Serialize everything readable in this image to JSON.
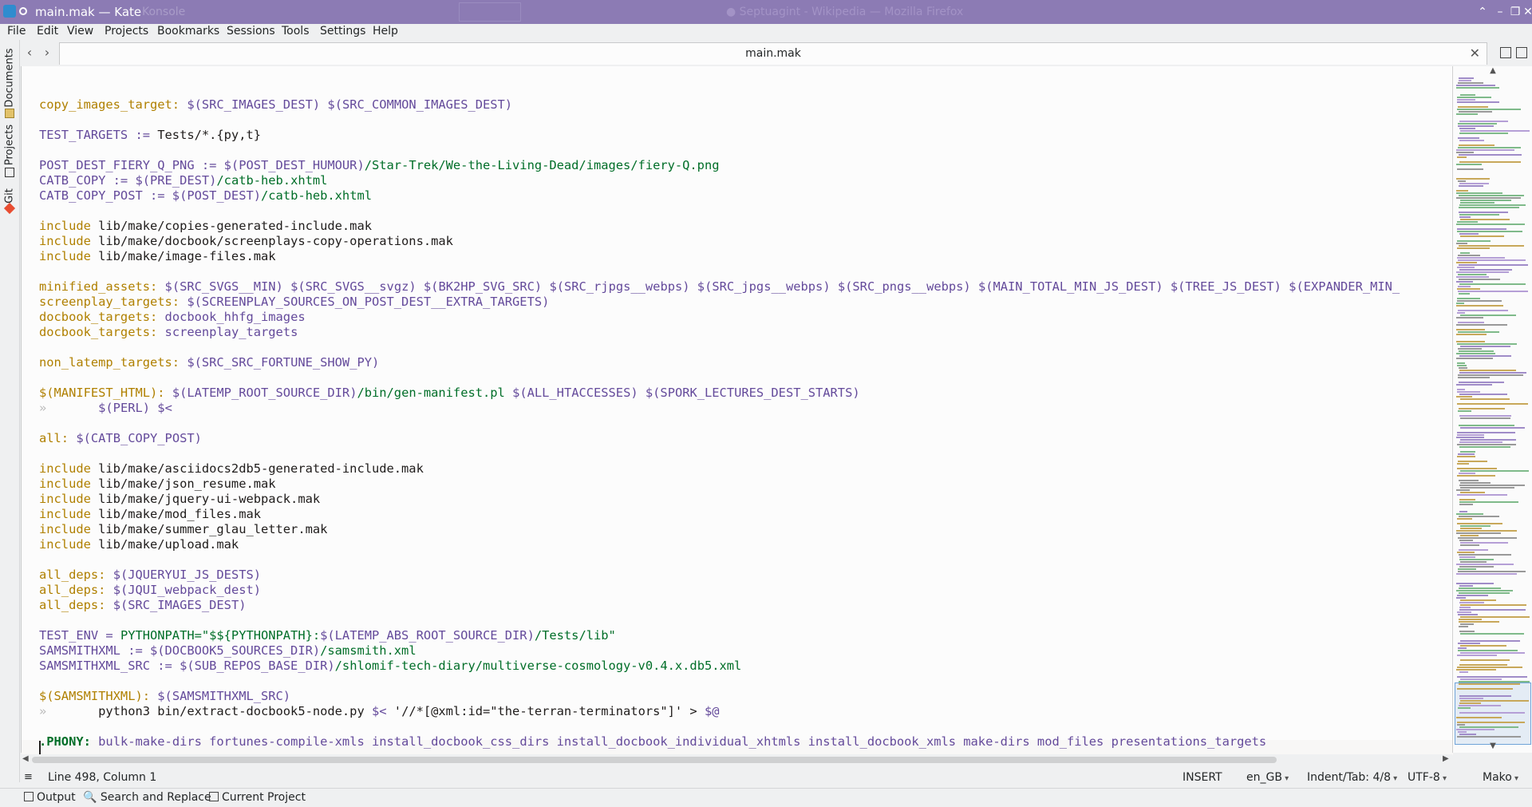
{
  "window": {
    "title": "main.mak — Kate",
    "background_window_1": "Konsole",
    "background_window_2": "Septuagint - Wikipedia — Mozilla Firefox"
  },
  "menu": [
    "File",
    "Edit",
    "View",
    "Projects",
    "Bookmarks",
    "Sessions",
    "Tools",
    "Settings",
    "Help"
  ],
  "sidebar": {
    "documents": "Documents",
    "projects": "Projects",
    "git": "Git"
  },
  "tab": {
    "label": "main.mak"
  },
  "code_lines": [
    [],
    [
      [
        "tgt",
        "copy_images_target:"
      ],
      [
        "plain",
        " "
      ],
      [
        "var",
        "$(SRC_IMAGES_DEST)"
      ],
      [
        "plain",
        " "
      ],
      [
        "var",
        "$(SRC_COMMON_IMAGES_DEST)"
      ]
    ],
    [],
    [
      [
        "var",
        "TEST_TARGETS := "
      ],
      [
        "plain",
        "Tests/*.{py,t}"
      ]
    ],
    [],
    [
      [
        "var",
        "POST_DEST_FIERY_Q_PNG := "
      ],
      [
        "var",
        "$(POST_DEST_HUMOUR)"
      ],
      [
        "path",
        "/Star-Trek/We-the-Living-Dead/images/fiery-Q.png"
      ]
    ],
    [
      [
        "var",
        "CATB_COPY := "
      ],
      [
        "var",
        "$(PRE_DEST)"
      ],
      [
        "path",
        "/catb-heb.xhtml"
      ]
    ],
    [
      [
        "var",
        "CATB_COPY_POST := "
      ],
      [
        "var",
        "$(POST_DEST)"
      ],
      [
        "path",
        "/catb-heb.xhtml"
      ]
    ],
    [],
    [
      [
        "tgt",
        "include"
      ],
      [
        "plain",
        " lib/make/copies-generated-include.mak"
      ]
    ],
    [
      [
        "tgt",
        "include"
      ],
      [
        "plain",
        " lib/make/docbook/screenplays-copy-operations.mak"
      ]
    ],
    [
      [
        "tgt",
        "include"
      ],
      [
        "plain",
        " lib/make/image-files.mak"
      ]
    ],
    [],
    [
      [
        "tgt",
        "minified_assets:"
      ],
      [
        "plain",
        " "
      ],
      [
        "var",
        "$(SRC_SVGS__MIN)"
      ],
      [
        "plain",
        " "
      ],
      [
        "var",
        "$(SRC_SVGS__svgz)"
      ],
      [
        "plain",
        " "
      ],
      [
        "var",
        "$(BK2HP_SVG_SRC)"
      ],
      [
        "plain",
        " "
      ],
      [
        "var",
        "$(SRC_rjpgs__webps)"
      ],
      [
        "plain",
        " "
      ],
      [
        "var",
        "$(SRC_jpgs__webps)"
      ],
      [
        "plain",
        " "
      ],
      [
        "var",
        "$(SRC_pngs__webps)"
      ],
      [
        "plain",
        " "
      ],
      [
        "var",
        "$(MAIN_TOTAL_MIN_JS_DEST)"
      ],
      [
        "plain",
        " "
      ],
      [
        "var",
        "$(TREE_JS_DEST)"
      ],
      [
        "plain",
        " "
      ],
      [
        "var",
        "$(EXPANDER_MIN_"
      ]
    ],
    [
      [
        "tgt",
        "screenplay_targets:"
      ],
      [
        "plain",
        " "
      ],
      [
        "var",
        "$(SCREENPLAY_SOURCES_ON_POST_DEST__EXTRA_TARGETS)"
      ]
    ],
    [
      [
        "tgt",
        "docbook_targets:"
      ],
      [
        "plain",
        " "
      ],
      [
        "var",
        "docbook_hhfg_images"
      ]
    ],
    [
      [
        "tgt",
        "docbook_targets:"
      ],
      [
        "plain",
        " "
      ],
      [
        "var",
        "screenplay_targets"
      ]
    ],
    [],
    [
      [
        "tgt",
        "non_latemp_targets:"
      ],
      [
        "plain",
        " "
      ],
      [
        "var",
        "$(SRC_SRC_FORTUNE_SHOW_PY)"
      ]
    ],
    [],
    [
      [
        "tgt",
        "$(MANIFEST_HTML):"
      ],
      [
        "plain",
        " "
      ],
      [
        "var",
        "$(LATEMP_ROOT_SOURCE_DIR)"
      ],
      [
        "path",
        "/bin/gen-manifest.pl"
      ],
      [
        "plain",
        " "
      ],
      [
        "var",
        "$(ALL_HTACCESSES)"
      ],
      [
        "plain",
        " "
      ],
      [
        "var",
        "$(SPORK_LECTURES_DEST_STARTS)"
      ]
    ],
    [
      [
        "tabmark",
        "»       "
      ],
      [
        "var",
        "$(PERL)"
      ],
      [
        "plain",
        " "
      ],
      [
        "var",
        "$<"
      ]
    ],
    [],
    [
      [
        "tgt",
        "all:"
      ],
      [
        "plain",
        " "
      ],
      [
        "var",
        "$(CATB_COPY_POST)"
      ]
    ],
    [],
    [
      [
        "tgt",
        "include"
      ],
      [
        "plain",
        " lib/make/asciidocs2db5-generated-include.mak"
      ]
    ],
    [
      [
        "tgt",
        "include"
      ],
      [
        "plain",
        " lib/make/json_resume.mak"
      ]
    ],
    [
      [
        "tgt",
        "include"
      ],
      [
        "plain",
        " lib/make/jquery-ui-webpack.mak"
      ]
    ],
    [
      [
        "tgt",
        "include"
      ],
      [
        "plain",
        " lib/make/mod_files.mak"
      ]
    ],
    [
      [
        "tgt",
        "include"
      ],
      [
        "plain",
        " lib/make/summer_glau_letter.mak"
      ]
    ],
    [
      [
        "tgt",
        "include"
      ],
      [
        "plain",
        " lib/make/upload.mak"
      ]
    ],
    [],
    [
      [
        "tgt",
        "all_deps:"
      ],
      [
        "plain",
        " "
      ],
      [
        "var",
        "$(JQUERYUI_JS_DESTS)"
      ]
    ],
    [
      [
        "tgt",
        "all_deps:"
      ],
      [
        "plain",
        " "
      ],
      [
        "var",
        "$(JQUI_webpack_dest)"
      ]
    ],
    [
      [
        "tgt",
        "all_deps:"
      ],
      [
        "plain",
        " "
      ],
      [
        "var",
        "$(SRC_IMAGES_DEST)"
      ]
    ],
    [],
    [
      [
        "var",
        "TEST_ENV = "
      ],
      [
        "path",
        "PYTHONPATH=\"$${PYTHONPATH}:"
      ],
      [
        "var",
        "$(LATEMP_ABS_ROOT_SOURCE_DIR)"
      ],
      [
        "path",
        "/Tests/lib\""
      ]
    ],
    [
      [
        "var",
        "SAMSMITHXML := "
      ],
      [
        "var",
        "$(DOCBOOK5_SOURCES_DIR)"
      ],
      [
        "path",
        "/samsmith.xml"
      ]
    ],
    [
      [
        "var",
        "SAMSMITHXML_SRC := "
      ],
      [
        "var",
        "$(SUB_REPOS_BASE_DIR)"
      ],
      [
        "path",
        "/shlomif-tech-diary/multiverse-cosmology-v0.4.x.db5.xml"
      ]
    ],
    [],
    [
      [
        "tgt",
        "$(SAMSMITHXML):"
      ],
      [
        "plain",
        " "
      ],
      [
        "var",
        "$(SAMSMITHXML_SRC)"
      ]
    ],
    [
      [
        "tabmark",
        "»       "
      ],
      [
        "plain",
        "python3 bin/extract-docbook5-node.py "
      ],
      [
        "var",
        "$<"
      ],
      [
        "plain",
        " '//*[@xml:id=\"the-terran-terminators\"]' > "
      ],
      [
        "var",
        "$@"
      ]
    ],
    [],
    [
      [
        "phony",
        ".PHONY:"
      ],
      [
        "plain",
        " "
      ],
      [
        "var",
        "bulk-make-dirs fortunes-compile-xmls install_docbook_css_dirs install_docbook_individual_xhtmls install_docbook_xmls make-dirs mod_files presentations_targets"
      ]
    ],
    []
  ],
  "status": {
    "position": "Line 498, Column 1",
    "mode": "INSERT",
    "language": "en_GB",
    "indent": "Indent/Tab: 4/8",
    "encoding": "UTF-8",
    "syntax": "Mako"
  },
  "bottom_tools": {
    "output": "Output",
    "search": "Search and Replace",
    "project": "Current Project"
  }
}
